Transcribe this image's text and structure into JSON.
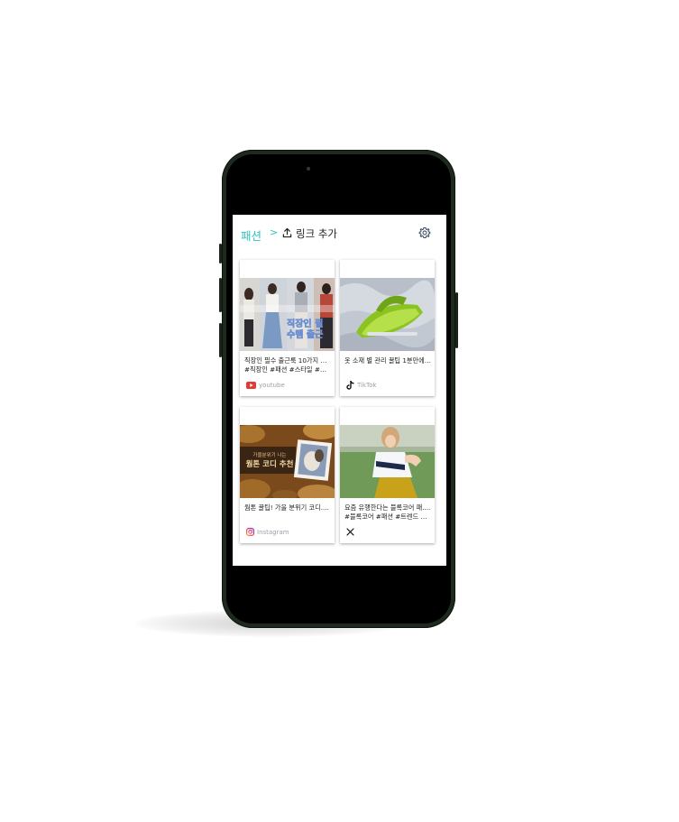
{
  "header": {
    "category": "패션",
    "separator": ">",
    "add_link_label": "링크 추가"
  },
  "cards": [
    {
      "caption_line1": "직장인 필수 출근룩 10가지 스...",
      "caption_line2": "#직장인 #패션 #스타일 #편...",
      "source": "youtube",
      "overlay_text": [
        "직장인 필",
        "수템 출근"
      ],
      "icon": "youtube-icon"
    },
    {
      "caption_line1": "옷 소재 별 관리 꿀팁 1분만에....",
      "caption_line2": "",
      "source": "TikTok",
      "icon": "tiktok-icon"
    },
    {
      "caption_line1": "웜톤 꿀팁! 가을 분위기 코디....",
      "caption_line2": "",
      "source": "Instagram",
      "overlay_small": "가을분위기 나는",
      "overlay_big": "웜톤 코디 추천",
      "icon": "instagram-icon"
    },
    {
      "caption_line1": "요즘 유행한다는 블록코어 패....",
      "caption_line2": "#블록코어 #패션 #트렌드 #힙...",
      "source": "",
      "icon": "x-icon"
    }
  ],
  "colors": {
    "accent": "#2ec4c0",
    "phone_frame": "#1f2a1f",
    "youtube": "#e53935"
  }
}
